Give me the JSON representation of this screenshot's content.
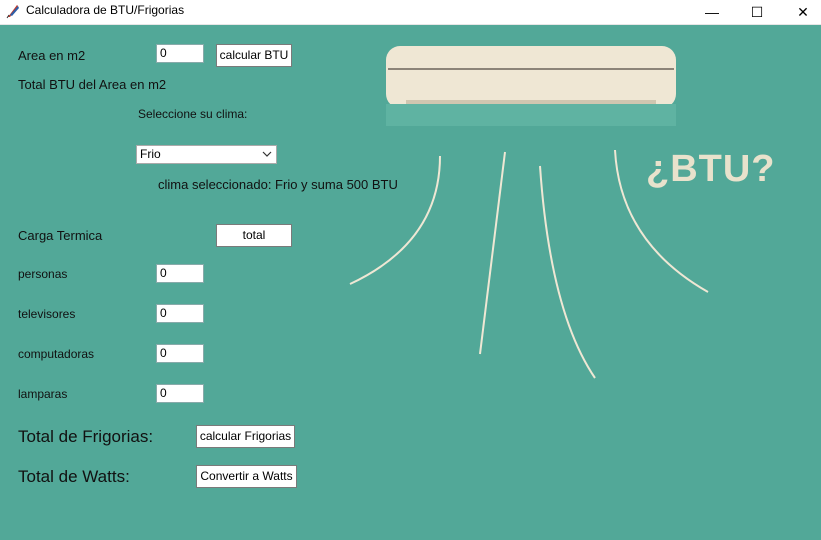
{
  "window": {
    "title": "Calculadora de BTU/Frigorias",
    "minimize": "—",
    "maximize": "☐",
    "close": "✕"
  },
  "area": {
    "label": "Area en m2",
    "value": "0",
    "button": "calcular BTU",
    "total_label": "Total BTU del Area en m2"
  },
  "clima": {
    "prompt": "Seleccione su clima:",
    "selected": "Frio",
    "status": "clima seleccionado: Frio y suma 500 BTU"
  },
  "carga": {
    "label": "Carga Termica",
    "button": "total",
    "rows": [
      {
        "label": "personas",
        "value": "0"
      },
      {
        "label": "televisores",
        "value": "0"
      },
      {
        "label": "computadoras",
        "value": "0"
      },
      {
        "label": "lamparas",
        "value": "0"
      }
    ]
  },
  "frigorias": {
    "label": "Total de Frigorias:",
    "button": "calcular Frigorias"
  },
  "watts": {
    "label": "Total de Watts:",
    "button": "Convertir a Watts"
  },
  "illustration": {
    "headline": "¿BTU?",
    "colors": {
      "unit": "#efe7d4",
      "airflow": "#efe7d4",
      "background": "#52a898"
    }
  }
}
